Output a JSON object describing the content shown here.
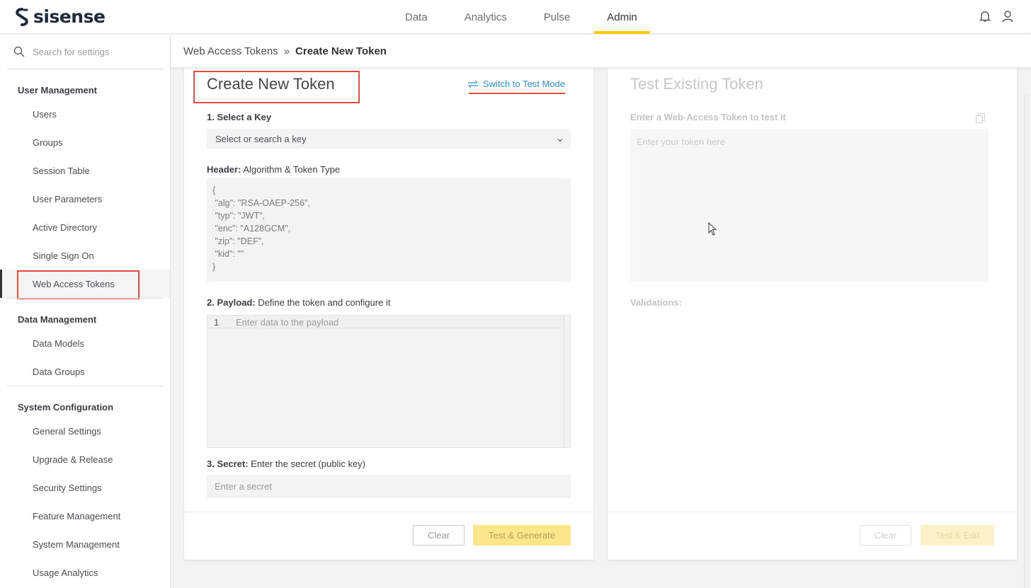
{
  "brand": {
    "name": "sisense"
  },
  "nav": {
    "tabs": [
      {
        "label": "Data"
      },
      {
        "label": "Analytics"
      },
      {
        "label": "Pulse"
      },
      {
        "label": "Admin"
      }
    ],
    "active": "Admin"
  },
  "sidebar": {
    "search_placeholder": "Search for settings",
    "sections": [
      {
        "title": "User Management",
        "items": [
          "Users",
          "Groups",
          "Session Table",
          "User Parameters",
          "Active Directory",
          "Single Sign On",
          "Web Access Tokens"
        ]
      },
      {
        "title": "Data Management",
        "items": [
          "Data Models",
          "Data Groups"
        ]
      },
      {
        "title": "System Configuration",
        "items": [
          "General Settings",
          "Upgrade & Release",
          "Security Settings",
          "Feature Management",
          "System Management",
          "Usage Analytics"
        ]
      }
    ],
    "active_item": "Web Access Tokens"
  },
  "breadcrumb": {
    "parent": "Web Access Tokens",
    "separator": "»",
    "current": "Create New Token"
  },
  "create_panel": {
    "title": "Create New Token",
    "switch_link": "Switch to Test Mode",
    "step1_label": "1. Select a Key",
    "select_placeholder": "Select or search a key",
    "header_label_bold": "Header:",
    "header_label_rest": " Algorithm & Token Type",
    "header_json": "{\n \"alg\": \"RSA-OAEP-256\",\n \"typ\": \"JWT\",\n \"enc\": \"A128GCM\",\n \"zip\": \"DEF\",\n \"kid\": \"\"\n}",
    "payload_label_bold": "2. Payload:",
    "payload_label_rest": " Define the token and configure it",
    "payload_line_no": "1",
    "payload_placeholder": "Enter data to the payload",
    "secret_label_bold": "3. Secret:",
    "secret_label_rest": " Enter the secret (public key)",
    "secret_placeholder": "Enter a secret",
    "clear_button": "Clear",
    "generate_button": "Test & Generate"
  },
  "test_panel": {
    "title": "Test Existing Token",
    "token_label": "Enter a Web-Access Token to test it",
    "token_placeholder": "Enter your token here",
    "validations_label": "Validations:",
    "clear_button": "Clear",
    "edit_button": "Test & Edit"
  },
  "colors": {
    "accent": "#ffcb05",
    "link": "#2e8fd6",
    "highlight": "#e74c3c"
  }
}
